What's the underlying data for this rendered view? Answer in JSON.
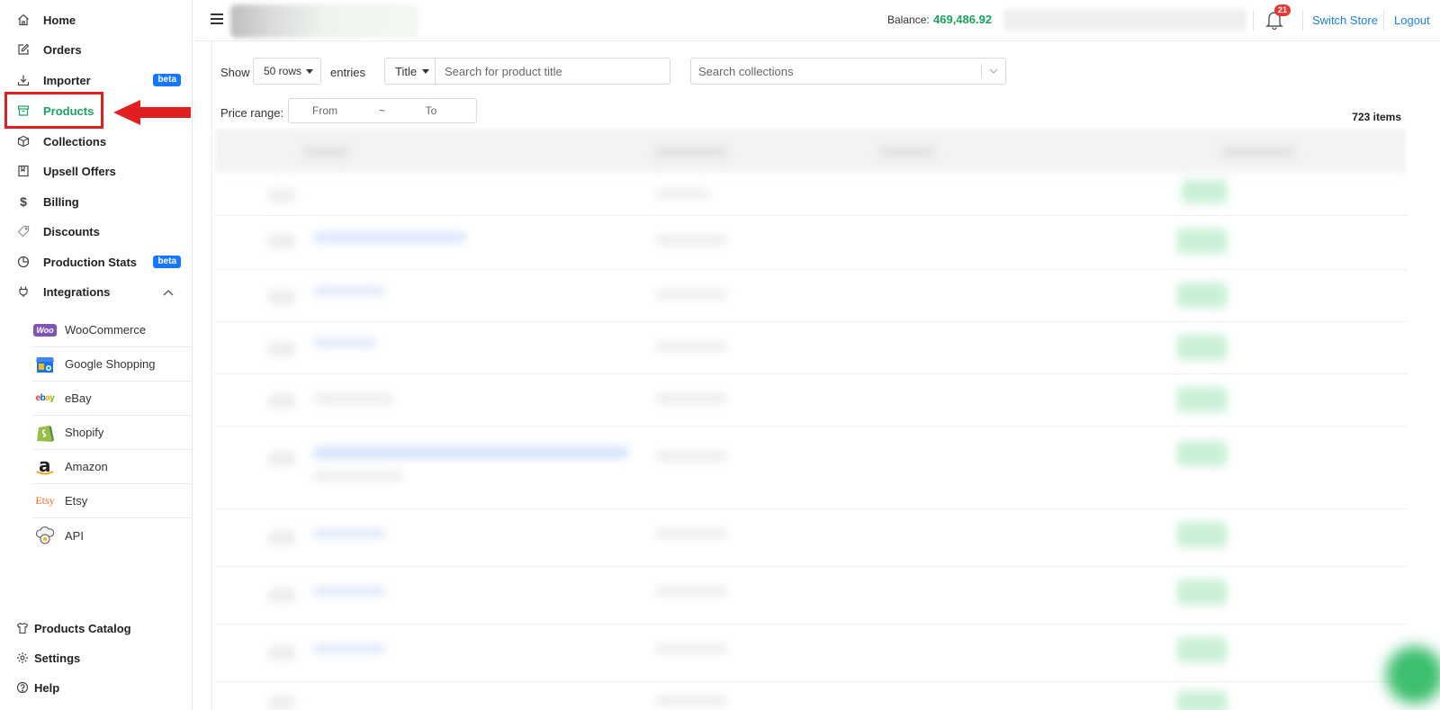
{
  "sidebar": {
    "nav": [
      {
        "label": "Home",
        "icon": "home-icon"
      },
      {
        "label": "Orders",
        "icon": "edit-icon"
      },
      {
        "label": "Importer",
        "icon": "download-icon",
        "badge": "beta"
      },
      {
        "label": "Products",
        "icon": "archive-box-icon",
        "active": true
      },
      {
        "label": "Collections",
        "icon": "cube-icon"
      },
      {
        "label": "Upsell Offers",
        "icon": "book-icon"
      },
      {
        "label": "Billing",
        "icon": "dollar-icon"
      },
      {
        "label": "Discounts",
        "icon": "tag-icon"
      },
      {
        "label": "Production Stats",
        "icon": "pie-chart-icon",
        "badge": "beta"
      },
      {
        "label": "Integrations",
        "icon": "plug-icon",
        "expanded": true
      }
    ],
    "integrations": [
      {
        "label": "WooCommerce",
        "icon": "woocommerce-logo-icon",
        "logo_text": "Woo"
      },
      {
        "label": "Google Shopping",
        "icon": "google-shopping-logo-icon"
      },
      {
        "label": "eBay",
        "icon": "ebay-logo-icon",
        "logo_text": "ebay"
      },
      {
        "label": "Shopify",
        "icon": "shopify-logo-icon"
      },
      {
        "label": "Amazon",
        "icon": "amazon-logo-icon",
        "logo_text": "a"
      },
      {
        "label": "Etsy",
        "icon": "etsy-logo-icon",
        "logo_text": "Etsy"
      },
      {
        "label": "API",
        "icon": "api-cloud-icon"
      }
    ],
    "bottom": [
      {
        "label": "Products Catalog",
        "icon": "tshirt-icon"
      },
      {
        "label": "Settings",
        "icon": "gear-icon"
      },
      {
        "label": "Help",
        "icon": "help-icon"
      }
    ]
  },
  "header": {
    "balance_label": "Balance:",
    "balance_value": "469,486.92",
    "notification_count": "21",
    "switch_store": "Switch Store",
    "logout": "Logout"
  },
  "filters": {
    "show_label": "Show",
    "rows_value": "50 rows",
    "entries_label": "entries",
    "title_field": "Title",
    "title_placeholder": "Search for product title",
    "collections_placeholder": "Search collections",
    "price_label": "Price range:",
    "price_from_placeholder": "From",
    "price_separator": "~",
    "price_to_placeholder": "To"
  },
  "table": {
    "items_count": "723 items"
  },
  "colors": {
    "accent_green": "#1aa260",
    "link_blue": "#1f7fd6",
    "badge_blue": "#1677ff",
    "highlight_red": "#e02020"
  }
}
